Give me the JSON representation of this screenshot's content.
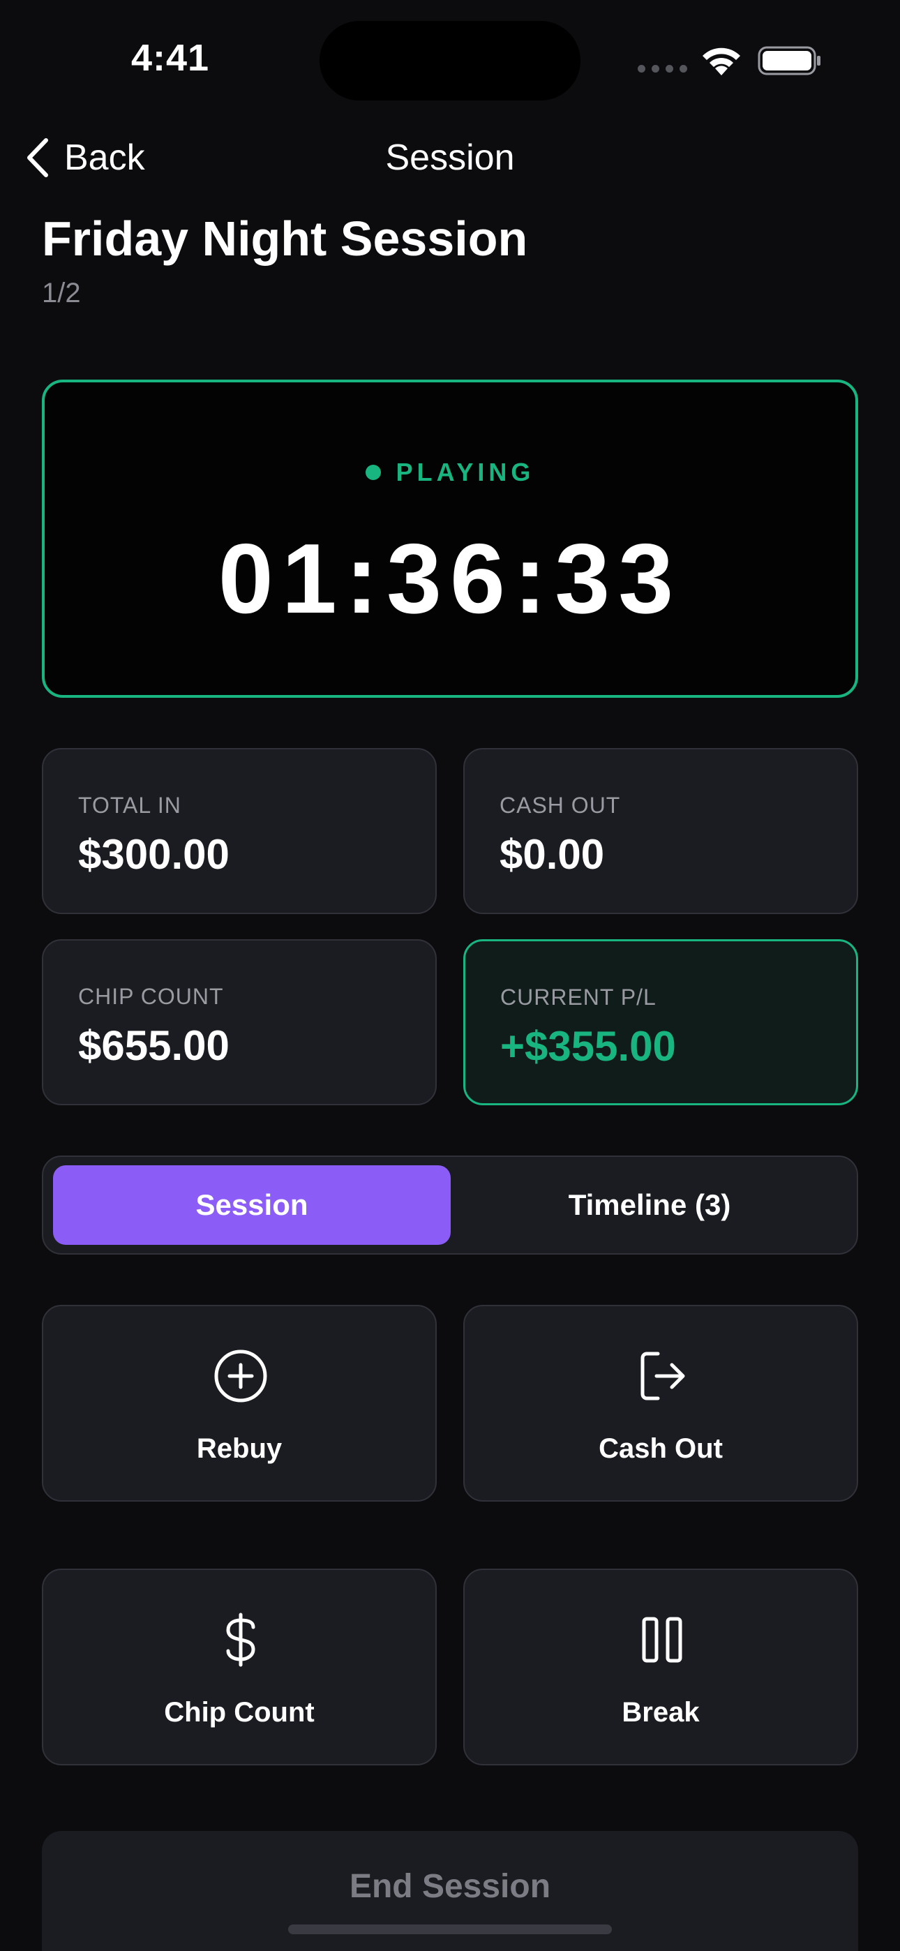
{
  "status_bar": {
    "time": "4:41"
  },
  "nav": {
    "back_label": "Back",
    "title": "Session"
  },
  "session": {
    "name": "Friday Night Session",
    "stakes": "1/2"
  },
  "timer": {
    "status": "PLAYING",
    "elapsed": "01:36:33"
  },
  "stats": {
    "total_in": {
      "label": "TOTAL IN",
      "value": "$300.00"
    },
    "cash_out": {
      "label": "CASH OUT",
      "value": "$0.00"
    },
    "chip_count": {
      "label": "CHIP COUNT",
      "value": "$655.00"
    },
    "current_pl": {
      "label": "CURRENT P/L",
      "value": "+$355.00"
    }
  },
  "tabs": [
    {
      "label": "Session",
      "active": true
    },
    {
      "label": "Timeline (3)",
      "active": false
    }
  ],
  "actions": {
    "rebuy": {
      "label": "Rebuy",
      "icon": "plus-circle-icon"
    },
    "cash_out": {
      "label": "Cash Out",
      "icon": "logout-icon"
    },
    "chip_count": {
      "label": "Chip Count",
      "icon": "dollar-icon"
    },
    "break": {
      "label": "Break",
      "icon": "pause-icon"
    }
  },
  "end_session_label": "End Session",
  "colors": {
    "accent_green": "#18b580",
    "accent_purple": "#8b5cf6",
    "background": "#0c0c0f",
    "card": "#1b1c22"
  }
}
